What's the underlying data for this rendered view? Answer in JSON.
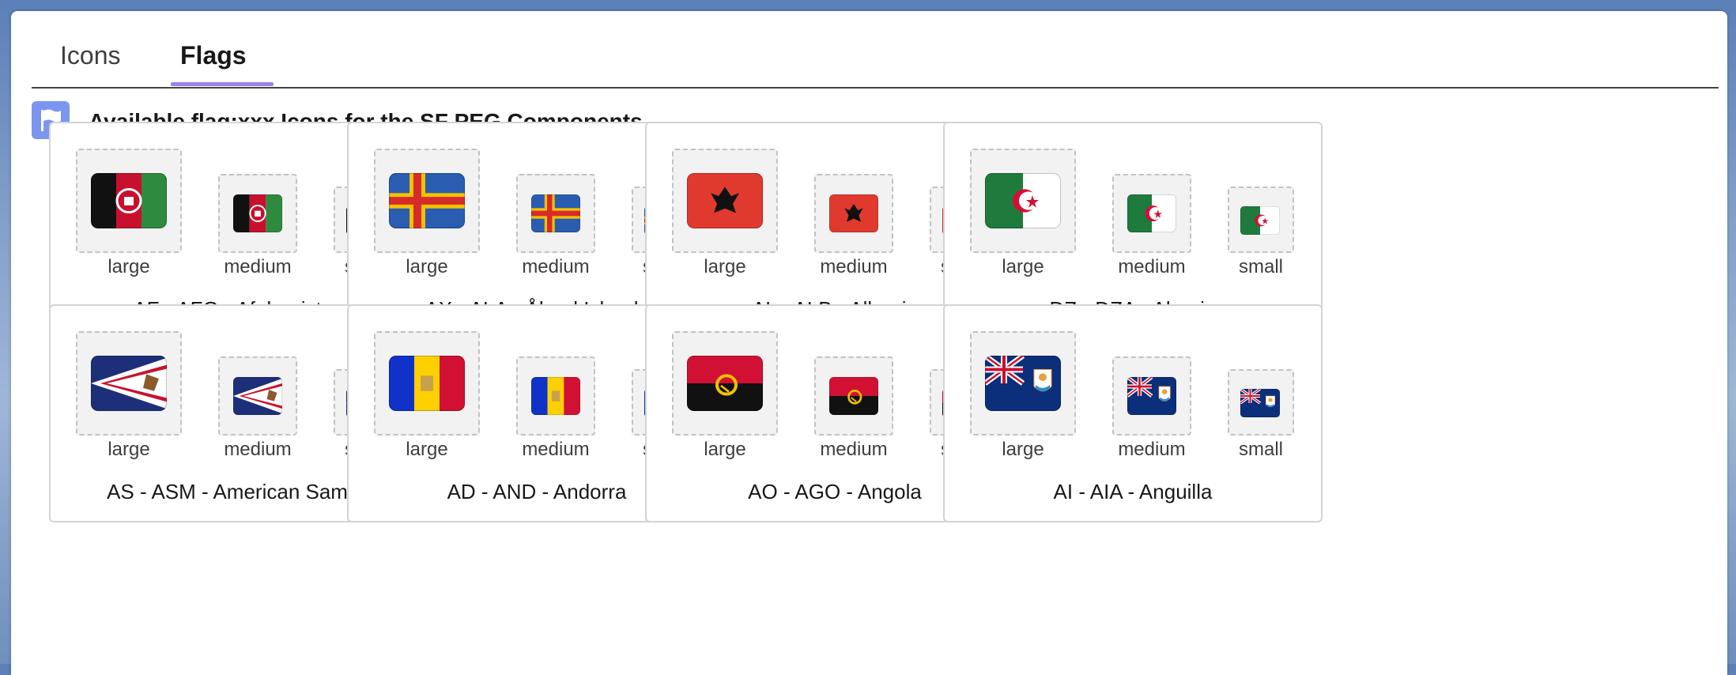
{
  "tabs": [
    {
      "label": "Icons",
      "active": false
    },
    {
      "label": "Flags",
      "active": true
    }
  ],
  "header": {
    "title": "Available flag:xxx Icons for the SF PEG Components",
    "icon": "flag-icon"
  },
  "size_labels": {
    "large": "large",
    "medium": "medium",
    "small": "small"
  },
  "cards": [
    {
      "code": "af",
      "name": "AF - AFG - Afghanistan"
    },
    {
      "code": "ax",
      "name": "AX - ALA - Åland Islands"
    },
    {
      "code": "al",
      "name": "AL - ALB - Albania"
    },
    {
      "code": "dz",
      "name": "DZ - DZA - Algeria"
    },
    {
      "code": "as",
      "name": "AS - ASM - American Samoa"
    },
    {
      "code": "ad",
      "name": "AD - AND - Andorra"
    },
    {
      "code": "ao",
      "name": "AO - AGO - Angola"
    },
    {
      "code": "ai",
      "name": "AI - AIA - Anguilla"
    }
  ],
  "colors": {
    "tab_accent": "#9b82e6",
    "header_icon_bg": "#7b96ee"
  }
}
